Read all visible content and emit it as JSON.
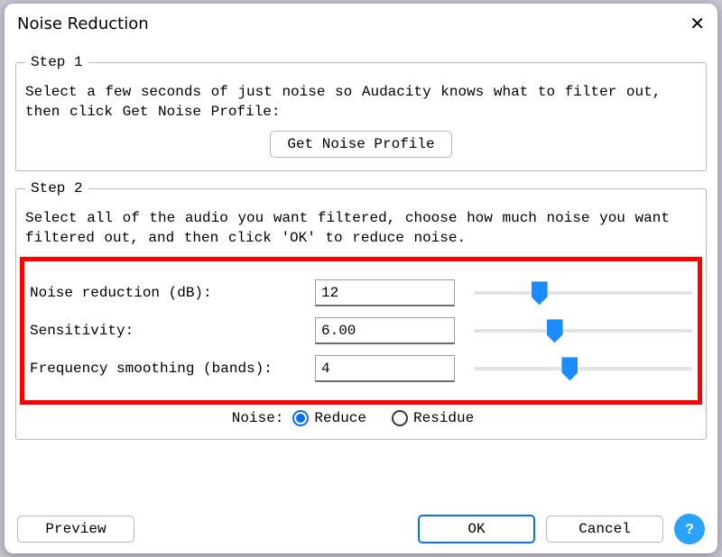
{
  "window": {
    "title": "Noise Reduction",
    "close_glyph": "✕"
  },
  "step1": {
    "legend": "Step 1",
    "desc": "Select a few seconds of just noise so Audacity knows what to filter out, then click Get Noise Profile:",
    "button": "Get Noise Profile"
  },
  "step2": {
    "legend": "Step 2",
    "desc": "Select all of the audio you want filtered, choose how much noise you want filtered out, and then click 'OK' to reduce noise.",
    "params": {
      "noise_reduction": {
        "label": "Noise reduction (dB):",
        "value": "12",
        "slider_pct": 30
      },
      "sensitivity": {
        "label": "Sensitivity:",
        "value": "6.00",
        "slider_pct": 37
      },
      "freq_smoothing": {
        "label": "Frequency smoothing (bands):",
        "value": "4",
        "slider_pct": 44
      }
    },
    "noise_label": "Noise:",
    "radio_reduce": "Reduce",
    "radio_residue": "Residue",
    "noise_selected": "reduce"
  },
  "footer": {
    "preview": "Preview",
    "ok": "OK",
    "cancel": "Cancel"
  }
}
